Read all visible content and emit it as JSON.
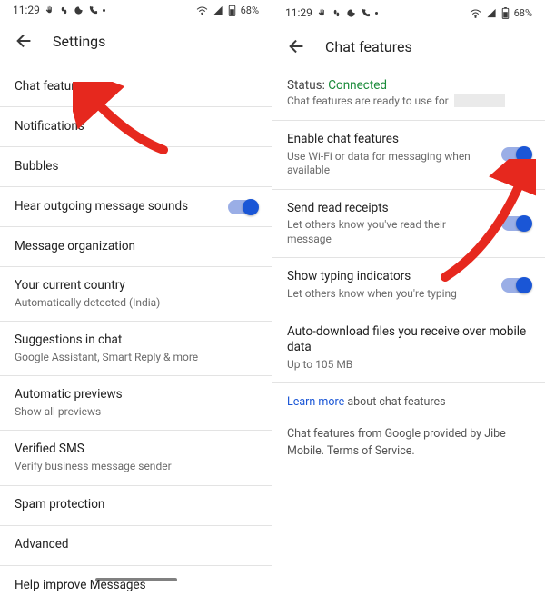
{
  "statusbar": {
    "time": "11:29",
    "battery": "68%"
  },
  "left": {
    "header": "Settings",
    "items": [
      {
        "title": "Chat features",
        "sub": ""
      },
      {
        "title": "Notifications",
        "sub": ""
      },
      {
        "title": "Bubbles",
        "sub": ""
      },
      {
        "title": "Hear outgoing message sounds",
        "sub": "",
        "toggle": true
      },
      {
        "title": "Message organization",
        "sub": ""
      },
      {
        "title": "Your current country",
        "sub": "Automatically detected (India)"
      },
      {
        "title": "Suggestions in chat",
        "sub": "Google Assistant, Smart Reply & more"
      },
      {
        "title": "Automatic previews",
        "sub": "Show all previews"
      },
      {
        "title": "Verified SMS",
        "sub": "Verify business message sender"
      },
      {
        "title": "Spam protection",
        "sub": ""
      },
      {
        "title": "Advanced",
        "sub": ""
      },
      {
        "title": "Help improve Messages",
        "sub": ""
      }
    ]
  },
  "right": {
    "header": "Chat features",
    "status_label": "Status:",
    "status_value": "Connected",
    "ready_text": "Chat features are ready to use for",
    "items": [
      {
        "title": "Enable chat features",
        "sub": "Use Wi-Fi or data for messaging when available",
        "toggle": true
      },
      {
        "title": "Send read receipts",
        "sub": "Let others know you've read their message",
        "toggle": true
      },
      {
        "title": "Show typing indicators",
        "sub": "Let others know when you're typing",
        "toggle": true
      },
      {
        "title": "Auto-download files you receive over mobile data",
        "sub": "Up to 105 MB"
      }
    ],
    "learn_more": "Learn more",
    "learn_more_suffix": " about chat features",
    "footer": "Chat features from Google provided by Jibe Mobile. Terms of Service."
  },
  "colors": {
    "accent": "#1a56d6",
    "connected": "#1a8b3a",
    "arrow": "#e6281e"
  }
}
